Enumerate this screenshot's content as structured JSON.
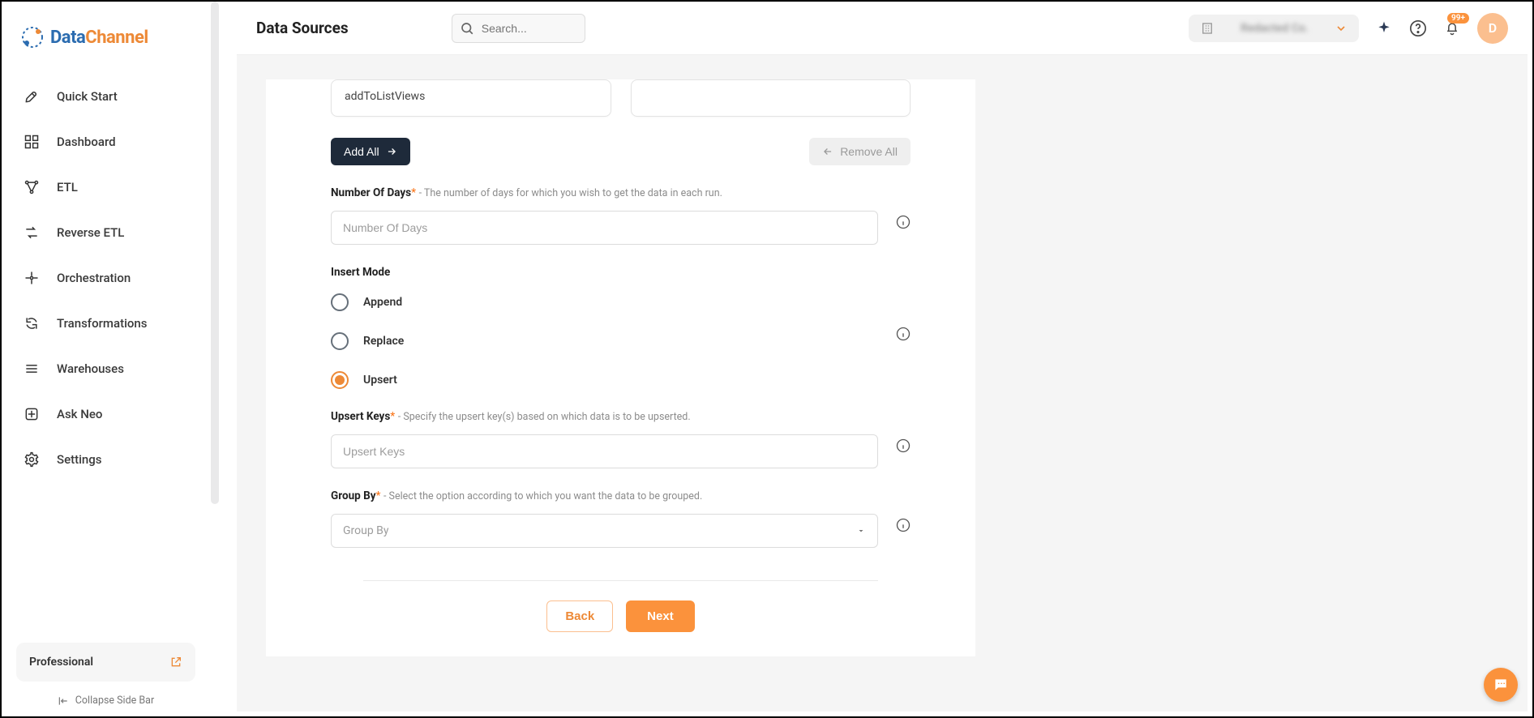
{
  "brand": {
    "part1": "Data",
    "part2": "Channel"
  },
  "sidebar": {
    "items": [
      {
        "label": "Quick Start"
      },
      {
        "label": "Dashboard"
      },
      {
        "label": "ETL"
      },
      {
        "label": "Reverse ETL"
      },
      {
        "label": "Orchestration"
      },
      {
        "label": "Transformations"
      },
      {
        "label": "Warehouses"
      },
      {
        "label": "Ask Neo"
      },
      {
        "label": "Settings"
      }
    ],
    "plan": "Professional",
    "collapse": "Collapse Side Bar"
  },
  "header": {
    "title": "Data Sources",
    "search_placeholder": "Search...",
    "account_name": "Redacted Co.",
    "badge": "99+",
    "avatar_initial": "D"
  },
  "form": {
    "list_left_item": "addToListViews",
    "add_all": "Add All",
    "remove_all": "Remove All",
    "num_days": {
      "label": "Number Of Days",
      "hint": "- The number of days for which you wish to get the data in each run.",
      "placeholder": "Number Of Days"
    },
    "insert_mode": {
      "label": "Insert Mode",
      "options": {
        "append": "Append",
        "replace": "Replace",
        "upsert": "Upsert"
      },
      "selected": "upsert"
    },
    "upsert_keys": {
      "label": "Upsert Keys",
      "hint": "- Specify the upsert key(s) based on which data is to be upserted.",
      "placeholder": "Upsert Keys"
    },
    "group_by": {
      "label": "Group By",
      "hint": "- Select the option according to which you want the data to be grouped.",
      "placeholder": "Group By"
    },
    "back": "Back",
    "next": "Next"
  }
}
